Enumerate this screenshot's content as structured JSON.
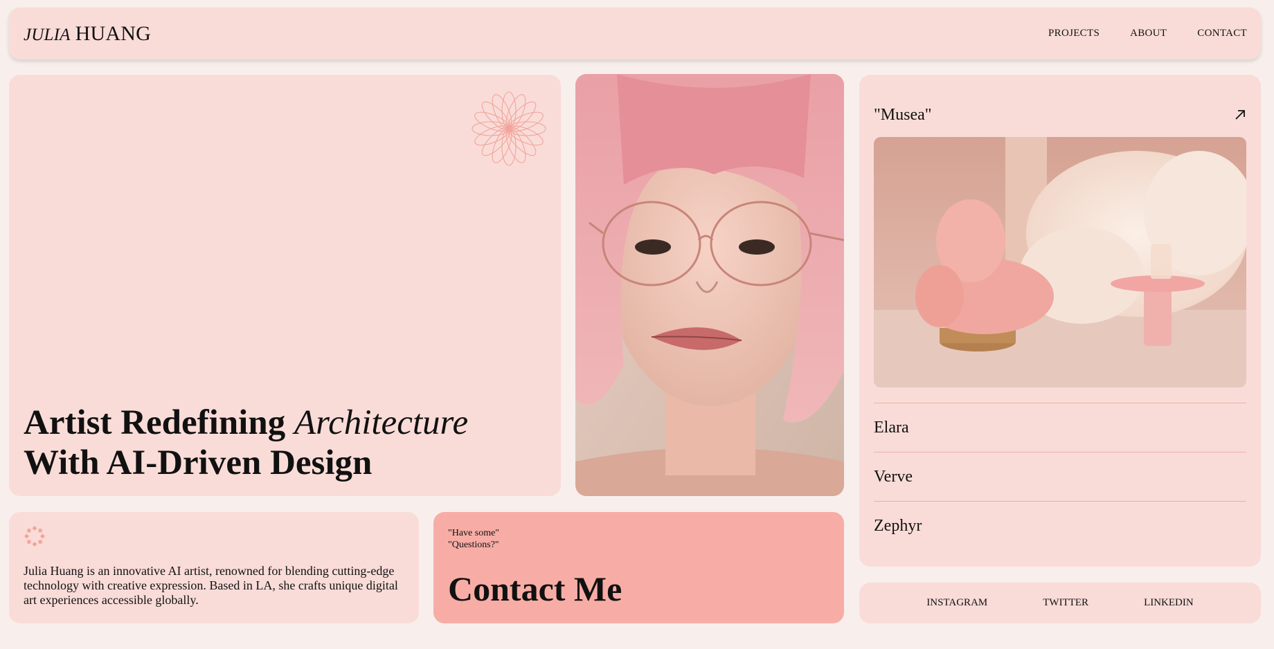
{
  "header": {
    "logo_first": "JULIA",
    "logo_last": "HUANG",
    "nav": [
      "PROJECTS",
      "ABOUT",
      "CONTACT"
    ]
  },
  "hero": {
    "title_part1": "Artist Redefining",
    "title_italic": "Architecture",
    "title_line2": "With AI-Driven Design"
  },
  "featured": {
    "title": "\"Musea\"",
    "arrow_icon": "arrow-up-right-icon"
  },
  "projects": [
    "Elara",
    "Verve",
    "Zephyr"
  ],
  "bio": {
    "text": "Julia Huang is an innovative AI artist, renowned for blending cutting-edge technology with creative expression. Based in LA, she crafts unique digital art experiences accessible globally."
  },
  "contact": {
    "line1": "\"Have some\"",
    "line2": "\"Questions?\"",
    "cta": "Contact Me"
  },
  "socials": [
    "INSTAGRAM",
    "TWITTER",
    "LINKEDIN"
  ],
  "colors": {
    "background": "#f8efec",
    "card": "#f9dcd8",
    "accent": "#f7ada5"
  }
}
